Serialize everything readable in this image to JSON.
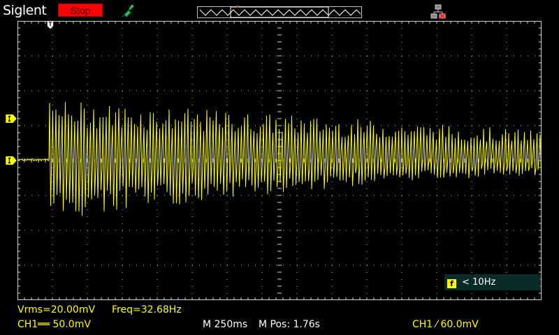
{
  "header": {
    "brand": "Siglent",
    "run_state": "Stop"
  },
  "colors": {
    "trace": "#ffff00",
    "stop_button": "#ff0000",
    "grid": "#d0d0d0",
    "trigger_panel": "#0b2a2a",
    "status_icon": "#22c55e"
  },
  "icons": {
    "status": "probe-icon",
    "network": "network-icon",
    "trigger_position": "trigger-position-icon",
    "ch1_level": "channel-1-marker-icon",
    "trigger_level": "trigger-level-marker-icon"
  },
  "trigger_panel": {
    "prefix": "f",
    "text": "< 10Hz"
  },
  "measurements": {
    "vrms": "Vrms=20.00mV",
    "freq": "Freq=32.68Hz"
  },
  "status_bar": {
    "ch1_scale": "CH1══ 50.0mV",
    "timebase": "M 250ms",
    "mpos": "M Pos: 1.76s",
    "trigger": "CH1 ⁄ 60.0mV"
  }
}
